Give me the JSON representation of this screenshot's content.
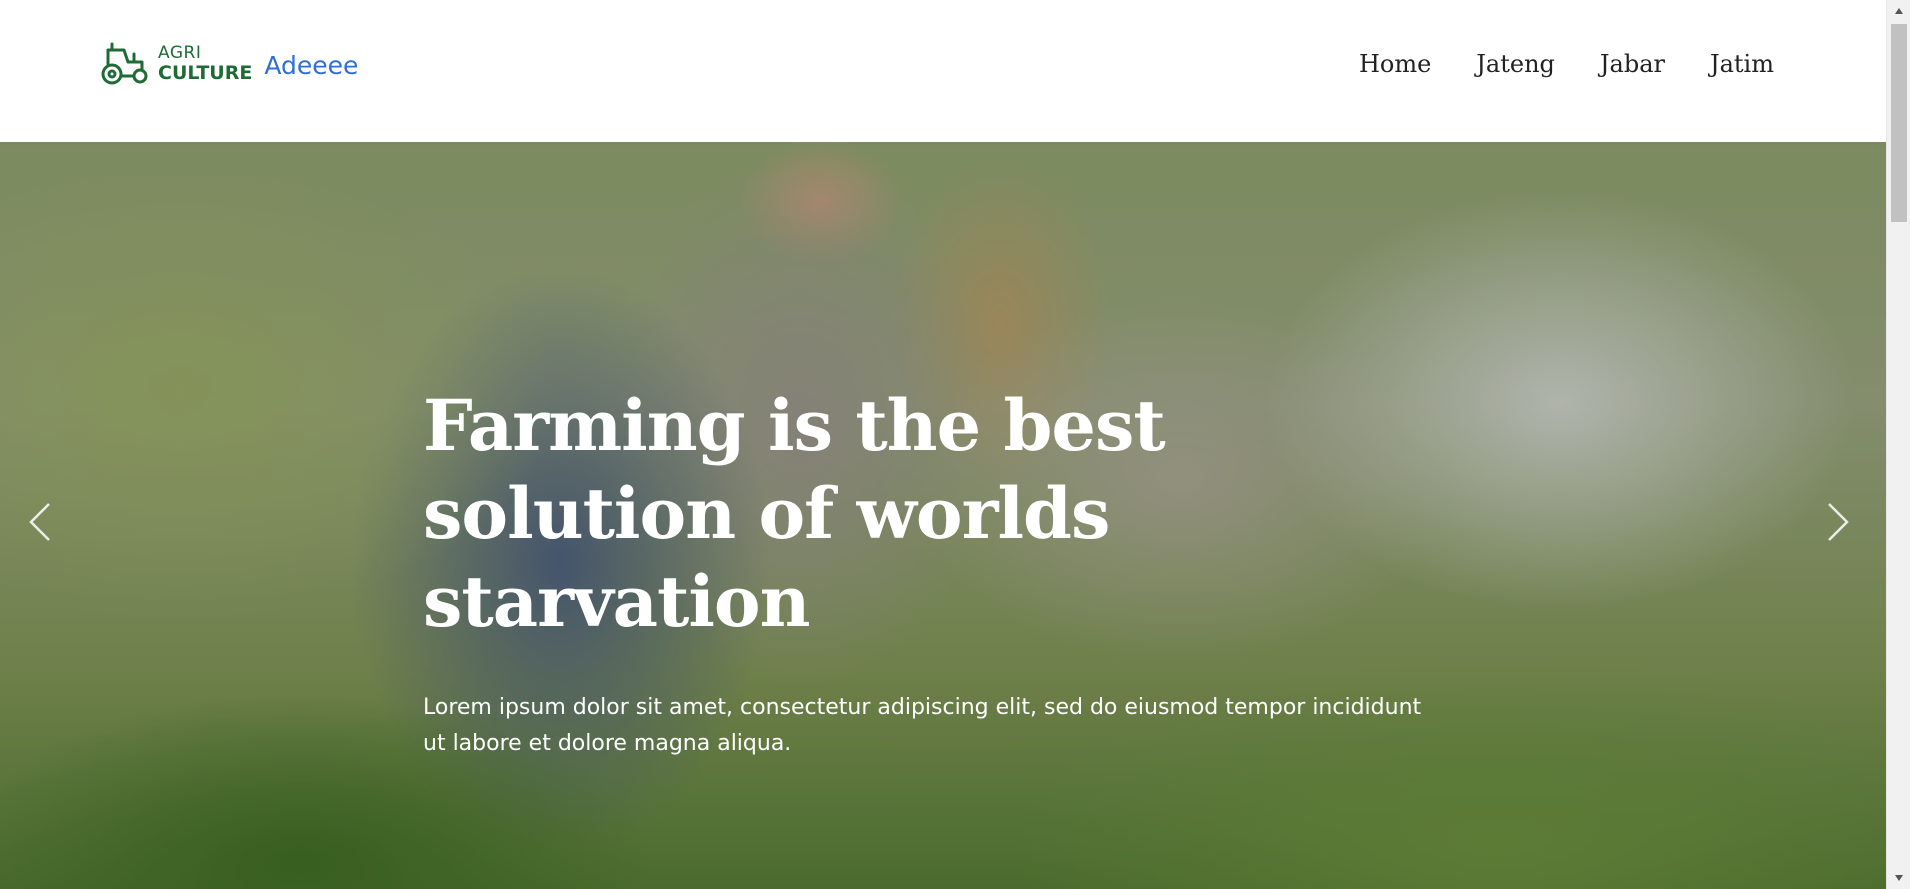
{
  "brand": {
    "logo_icon": "tractor-icon",
    "logo_line1": "AGRI",
    "logo_line2": "CULTURE",
    "name": "Adeeee",
    "colors": {
      "logo": "#1f6b36",
      "name": "#2f6fd6"
    }
  },
  "nav": {
    "items": [
      {
        "label": "Home"
      },
      {
        "label": "Jateng"
      },
      {
        "label": "Jabar"
      },
      {
        "label": "Jatim"
      }
    ]
  },
  "hero": {
    "title": "Farming is the best solution of worlds starvation",
    "text": "Lorem ipsum dolor sit amet, consectetur adipiscing elit, sed do eiusmod tempor incididunt ut labore et dolore magna aliqua.",
    "prev_icon": "chevron-left-icon",
    "next_icon": "chevron-right-icon"
  },
  "scrollbar": {
    "up_icon": "triangle-up-icon",
    "down_icon": "triangle-down-icon"
  }
}
